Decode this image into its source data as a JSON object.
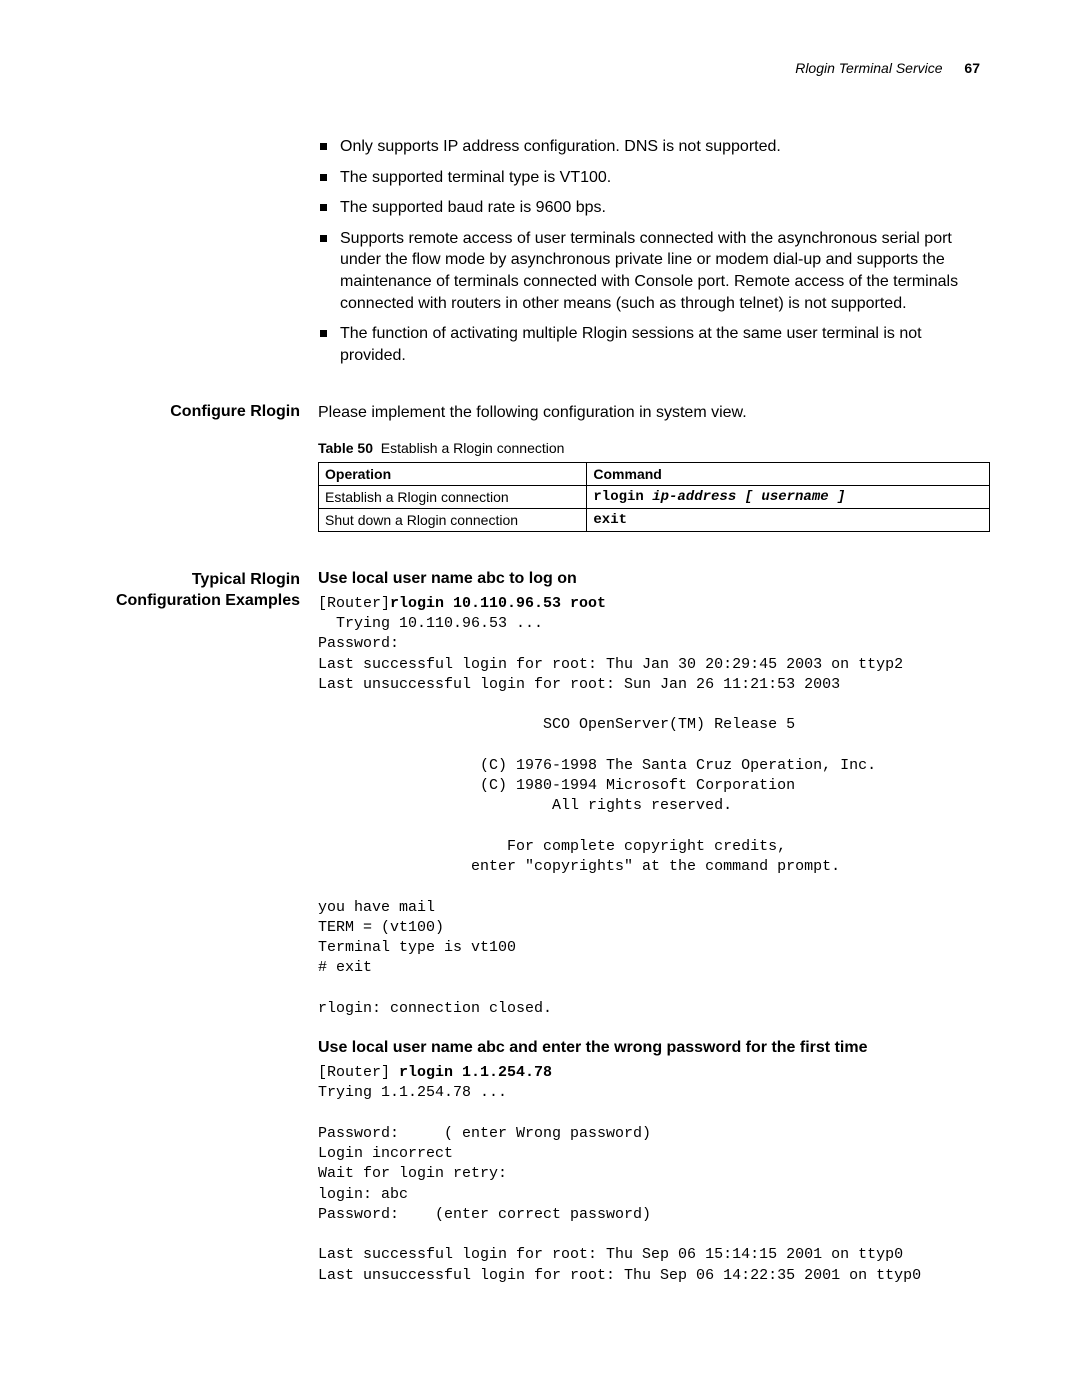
{
  "header": {
    "title": "Rlogin Terminal Service",
    "page": "67"
  },
  "bullets": [
    "Only supports IP address configuration. DNS is not supported.",
    "The supported terminal type is VT100.",
    "The supported baud rate is 9600 bps.",
    "Supports remote access of user terminals connected with the asynchronous serial port under the flow mode by asynchronous private line or modem dial-up and supports the maintenance of terminals connected with Console port. Remote access of the terminals connected with routers in other means (such as through telnet) is not supported.",
    "The function of activating multiple Rlogin sessions at the same user terminal is not provided."
  ],
  "configure": {
    "label": "Configure Rlogin",
    "intro": "Please implement the following configuration in system view.",
    "table_label": "Table 50",
    "table_caption": "Establish a Rlogin connection",
    "headers": {
      "op": "Operation",
      "cmd": "Command"
    },
    "rows": [
      {
        "op": "Establish a Rlogin connection",
        "cmd_prefix": "rlogin ",
        "cmd_args": "ip-address [ username ]"
      },
      {
        "op": "Shut down a Rlogin connection",
        "cmd_prefix": "exit",
        "cmd_args": ""
      }
    ]
  },
  "examples": {
    "label": "Typical Rlogin Configuration Examples",
    "ex1": {
      "title": "Use local user name abc to log on",
      "prompt_prefix": "[Router]",
      "cmd": "rlogin 10.110.96.53 root",
      "body": "  Trying 10.110.96.53 ...\nPassword:\nLast successful login for root: Thu Jan 30 20:29:45 2003 on ttyp2\nLast unsuccessful login for root: Sun Jan 26 11:21:53 2003\n\n                         SCO OpenServer(TM) Release 5\n\n                  (C) 1976-1998 The Santa Cruz Operation, Inc.\n                  (C) 1980-1994 Microsoft Corporation\n                          All rights reserved.\n\n                     For complete copyright credits,\n                 enter \"copyrights\" at the command prompt.\n\nyou have mail\nTERM = (vt100)\nTerminal type is vt100\n# exit\n\nrlogin: connection closed."
    },
    "ex2": {
      "title": "Use local user name abc and enter the wrong password for the first time",
      "prompt_prefix": "[Router] ",
      "cmd": "rlogin 1.1.254.78",
      "body": "Trying 1.1.254.78 ...\n\nPassword:     ( enter Wrong password)\nLogin incorrect\nWait for login retry:\nlogin: abc\nPassword:    (enter correct password)\n\nLast successful login for root: Thu Sep 06 15:14:15 2001 on ttyp0\nLast unsuccessful login for root: Thu Sep 06 14:22:35 2001 on ttyp0"
    }
  }
}
